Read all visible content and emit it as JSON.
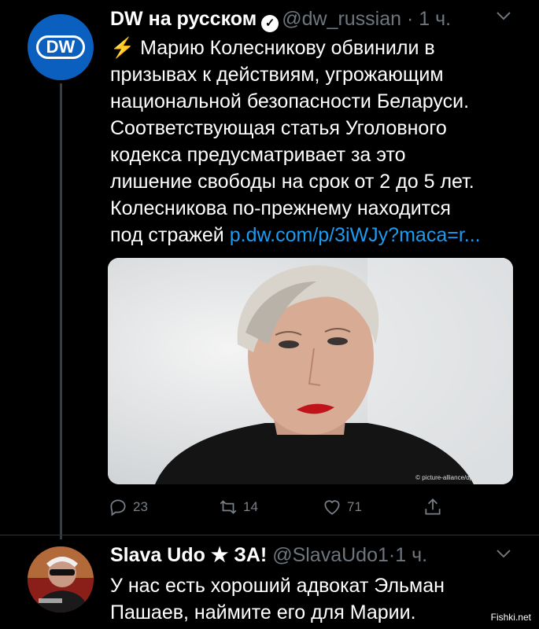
{
  "tweet": {
    "avatar_text": "DW",
    "display_name": "DW на русском",
    "verified_glyph": "✓",
    "handle": "@dw_russian",
    "separator": "·",
    "time": "1 ч.",
    "lines": [
      "Марию Колесникову обвинили в",
      "призывах к действиям, угрожающим",
      "национальной безопасности Беларуси.",
      "Соответствующая статья Уголовного",
      "кодекса предусматривает за это",
      "лишение свободы на срок от 2 до 5 лет.",
      "Колесникова по-прежнему находится"
    ],
    "last_line_text": "под стражей",
    "link": "p.dw.com/p/3iWJy?maca=r...",
    "bolt_icon": "lightning-bolt-emoji",
    "photo_credit": "© picture-alliance/dpa/V. Dubinin",
    "reply_count": "23",
    "retweet_count": "14",
    "like_count": "71"
  },
  "reply": {
    "display_name": "Slava Udo",
    "star": "★",
    "name_suffix": "ЗА!",
    "handle": "@SlavaUdo1",
    "separator": "·",
    "time": "1 ч.",
    "text_line1": "У нас есть хороший адвокат Эльман",
    "text_line2": "Пашаев, наймите его для Марии."
  },
  "watermark": "Fishki.net",
  "colors": {
    "background": "#000000",
    "link": "#1d9bf0",
    "muted": "#6e767d",
    "dw_blue": "#0b5fbf"
  }
}
